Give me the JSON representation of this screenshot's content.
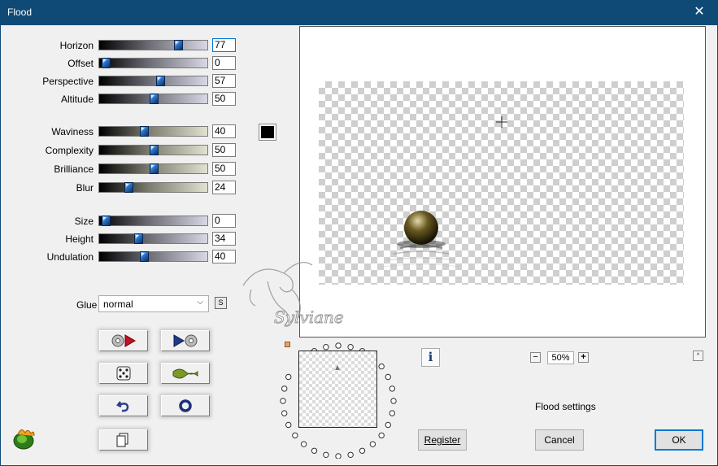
{
  "window": {
    "title": "Flood",
    "close_glyph": "✕"
  },
  "groups": [
    [
      {
        "id": "horizon",
        "label": "Horizon",
        "value": "77",
        "style": "g1",
        "fraction": 0.75
      },
      {
        "id": "offset",
        "label": "Offset",
        "value": "0",
        "style": "g1",
        "fraction": 0.0
      },
      {
        "id": "perspective",
        "label": "Perspective",
        "value": "57",
        "style": "g1",
        "fraction": 0.57
      },
      {
        "id": "altitude",
        "label": "Altitude",
        "value": "50",
        "style": "g1",
        "fraction": 0.5
      }
    ],
    [
      {
        "id": "waviness",
        "label": "Waviness",
        "value": "40",
        "style": "g2",
        "fraction": 0.4
      },
      {
        "id": "complexity",
        "label": "Complexity",
        "value": "50",
        "style": "g2",
        "fraction": 0.5
      },
      {
        "id": "brilliance",
        "label": "Brilliance",
        "value": "50",
        "style": "g2",
        "fraction": 0.5
      },
      {
        "id": "blur",
        "label": "Blur",
        "value": "24",
        "style": "g2",
        "fraction": 0.24
      }
    ],
    [
      {
        "id": "size",
        "label": "Size",
        "value": "0",
        "style": "g1",
        "fraction": 0.0
      },
      {
        "id": "height",
        "label": "Height",
        "value": "34",
        "style": "g1",
        "fraction": 0.34
      },
      {
        "id": "undulation",
        "label": "Undulation",
        "value": "40",
        "style": "g1",
        "fraction": 0.4
      }
    ]
  ],
  "color": {
    "swatch": "#000000"
  },
  "glue": {
    "label": "Glue",
    "value": "normal",
    "s_button": "S"
  },
  "zoom": {
    "value": "50%",
    "minus": "−",
    "plus": "+"
  },
  "info_glyph": "i",
  "collapse_glyph": "^",
  "settings_label": "Flood settings",
  "buttons": {
    "register": "Register",
    "cancel": "Cancel",
    "ok": "OK"
  },
  "watermark_text": "Sylviane"
}
